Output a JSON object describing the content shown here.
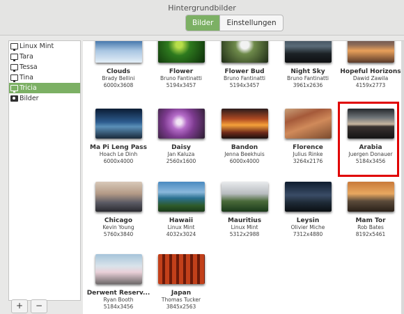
{
  "window": {
    "title": "Hintergrundbilder",
    "tabs": [
      {
        "label": "Bilder",
        "active": true
      },
      {
        "label": "Einstellungen",
        "active": false
      }
    ]
  },
  "sidebar": {
    "items": [
      {
        "label": "Linux Mint",
        "icon": "monitor-icon"
      },
      {
        "label": "Tara",
        "icon": "monitor-icon"
      },
      {
        "label": "Tessa",
        "icon": "monitor-icon"
      },
      {
        "label": "Tina",
        "icon": "monitor-icon"
      },
      {
        "label": "Tricia",
        "icon": "monitor-icon",
        "selected": true
      },
      {
        "label": "Bilder",
        "icon": "camera-icon"
      }
    ],
    "add_label": "+",
    "remove_label": "−"
  },
  "wallpapers": [
    {
      "name": "Clouds",
      "author": "Brady Bellini",
      "resolution": "6000x3608"
    },
    {
      "name": "Flower",
      "author": "Bruno Fantinatti",
      "resolution": "5194x3457"
    },
    {
      "name": "Flower Bud",
      "author": "Bruno Fantinatti",
      "resolution": "5194x3457"
    },
    {
      "name": "Night Sky",
      "author": "Bruno Fantinatti",
      "resolution": "3961x2636"
    },
    {
      "name": "Hopeful Horizons",
      "author": "Dawid Zawila",
      "resolution": "4159x2773"
    },
    {
      "name": "Ma Pi Leng Pass",
      "author": "Hoach Le Dinh",
      "resolution": "6000x4000"
    },
    {
      "name": "Daisy",
      "author": "Jan Kaluza",
      "resolution": "2560x1600"
    },
    {
      "name": "Bandon",
      "author": "Jenna Beekhuis",
      "resolution": "6000x4000"
    },
    {
      "name": "Florence",
      "author": "Julius Rinke",
      "resolution": "3264x2176"
    },
    {
      "name": "Arabia",
      "author": "Juergen Donauer",
      "resolution": "5184x3456",
      "highlighted": true
    },
    {
      "name": "Chicago",
      "author": "Kevin Young",
      "resolution": "5760x3840"
    },
    {
      "name": "Hawaii",
      "author": "Linux Mint",
      "resolution": "4032x3024"
    },
    {
      "name": "Mauritius",
      "author": "Linux Mint",
      "resolution": "5312x2988"
    },
    {
      "name": "Leysin",
      "author": "Olivier Miche",
      "resolution": "7312x4880"
    },
    {
      "name": "Mam Tor",
      "author": "Rob Bates",
      "resolution": "8192x5461"
    },
    {
      "name": "Derwent Reserv...",
      "author": "Ryan Booth",
      "resolution": "5184x3456"
    },
    {
      "name": "Japan",
      "author": "Thomas Tucker",
      "resolution": "3845x2563"
    }
  ],
  "colors": {
    "accent": "#7cb064",
    "highlight": "#e00000"
  }
}
